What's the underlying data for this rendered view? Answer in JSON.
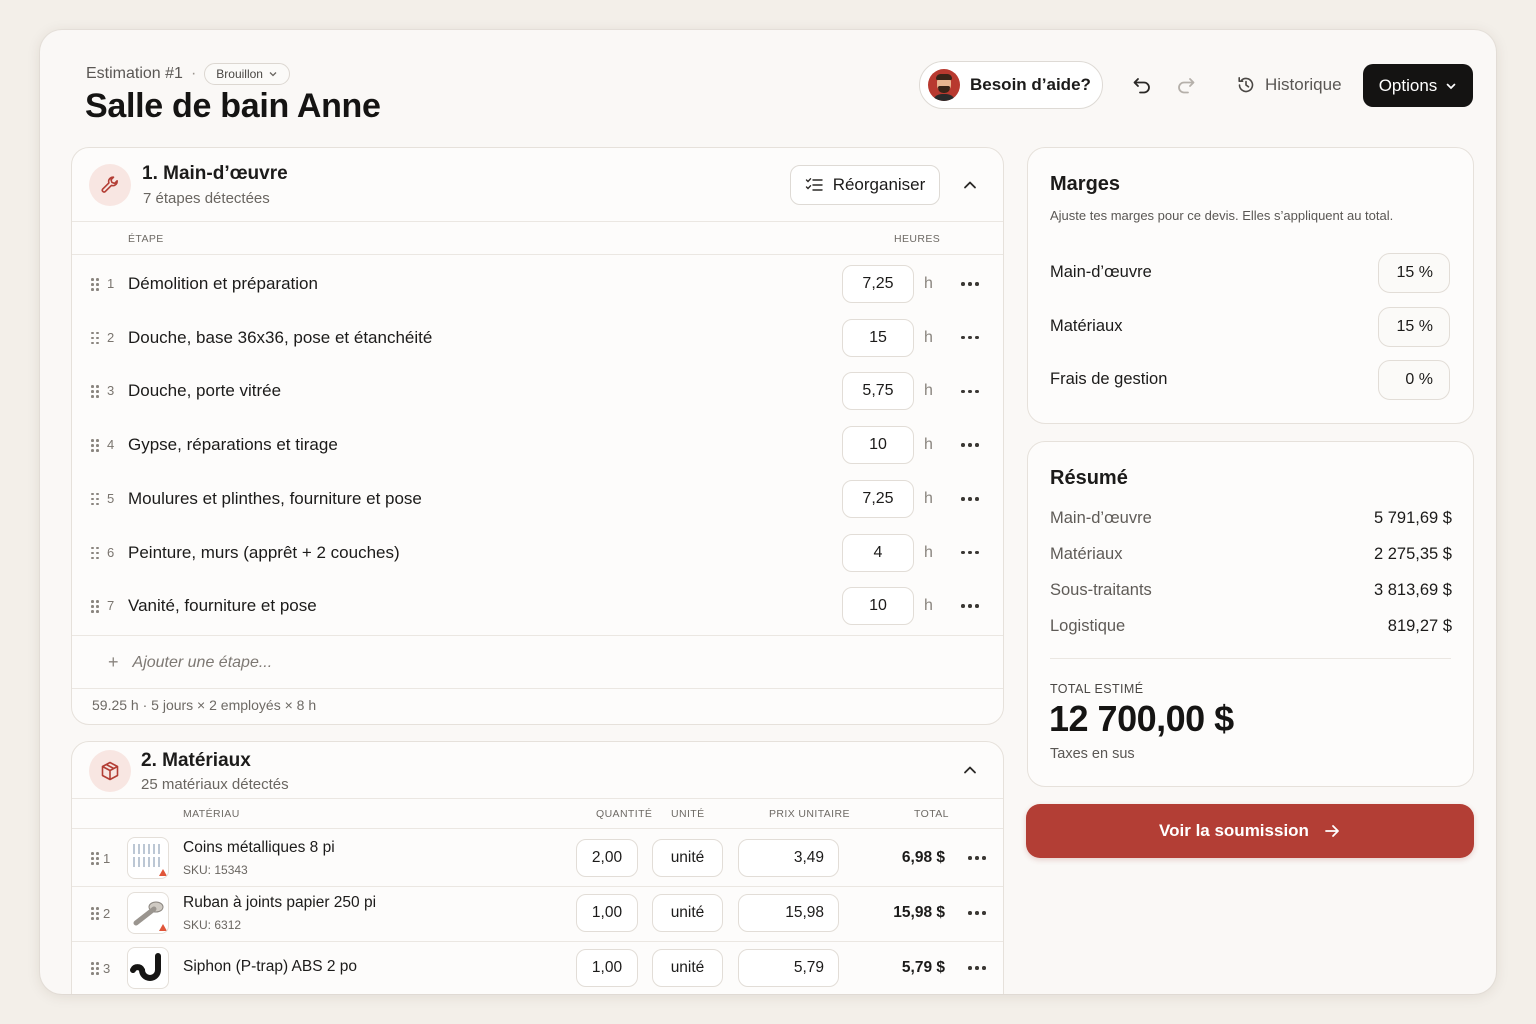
{
  "header": {
    "breadcrumb": "Estimation #1",
    "status_badge": "Brouillon",
    "title": "Salle de bain Anne",
    "help_label": "Besoin d’aide?",
    "history_label": "Historique",
    "options_label": "Options"
  },
  "labor": {
    "title": "1. Main-d’œuvre",
    "subtitle": "7 étapes détectées",
    "reorder_label": "Réorganiser",
    "col_step": "ÉTAPE",
    "col_hours": "HEURES",
    "hours_unit": "h",
    "rows": [
      {
        "num": "1",
        "label": "Démolition et préparation",
        "hours": "7,25"
      },
      {
        "num": "2",
        "label": "Douche, base 36x36, pose et étanchéité",
        "hours": "15"
      },
      {
        "num": "3",
        "label": "Douche, porte vitrée",
        "hours": "5,75"
      },
      {
        "num": "4",
        "label": "Gypse, réparations et tirage",
        "hours": "10"
      },
      {
        "num": "5",
        "label": "Moulures et plinthes, fourniture et pose",
        "hours": "7,25"
      },
      {
        "num": "6",
        "label": "Peinture, murs (apprêt + 2 couches)",
        "hours": "4"
      },
      {
        "num": "7",
        "label": "Vanité, fourniture et pose",
        "hours": "10"
      }
    ],
    "add_placeholder": "Ajouter une étape...",
    "footer_note": "59.25 h · 5 jours × 2 employés × 8 h"
  },
  "materials": {
    "title": "2. Matériaux",
    "subtitle": "25 matériaux détectés",
    "col_material": "MATÉRIAU",
    "col_qty": "QUANTITÉ",
    "col_unit": "UNITÉ",
    "col_price": "PRIX UNITAIRE",
    "col_total": "TOTAL",
    "rows": [
      {
        "num": "1",
        "name": "Coins métalliques 8 pi",
        "sku": "SKU: 15343",
        "qty": "2,00",
        "unit": "unité",
        "price": "3,49",
        "total": "6,98 $"
      },
      {
        "num": "2",
        "name": "Ruban à joints papier 250 pi",
        "sku": "SKU: 6312",
        "qty": "1,00",
        "unit": "unité",
        "price": "15,98",
        "total": "15,98 $"
      },
      {
        "num": "3",
        "name": "Siphon (P-trap) ABS 2 po",
        "sku": "",
        "qty": "1,00",
        "unit": "unité",
        "price": "5,79",
        "total": "5,79 $"
      }
    ]
  },
  "margins": {
    "title": "Marges",
    "description": "Ajuste tes marges pour ce devis. Elles s’appliquent au total.",
    "items": [
      {
        "label": "Main-d’œuvre",
        "value": "15 %"
      },
      {
        "label": "Matériaux",
        "value": "15 %"
      },
      {
        "label": "Frais de gestion",
        "value": "0 %"
      }
    ]
  },
  "summary": {
    "title": "Résumé",
    "items": [
      {
        "label": "Main-d’œuvre",
        "value": "5 791,69 $"
      },
      {
        "label": "Matériaux",
        "value": "2 275,35 $"
      },
      {
        "label": "Sous-traitants",
        "value": "3 813,69 $"
      },
      {
        "label": "Logistique",
        "value": "819,27 $"
      }
    ],
    "total_label": "TOTAL ESTIMÉ",
    "total_value": "12 700,00 $",
    "tax_note": "Taxes en sus"
  },
  "cta": {
    "label": "Voir la soumission"
  },
  "colors": {
    "accent": "#b33e35",
    "dark": "#141312",
    "background": "#faf8f6"
  }
}
